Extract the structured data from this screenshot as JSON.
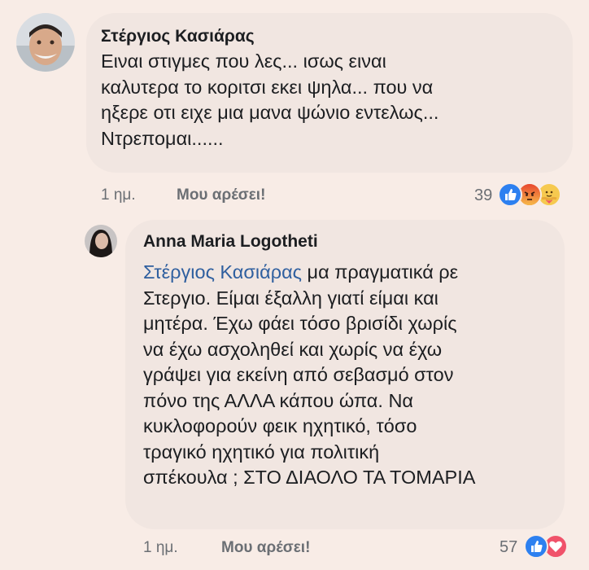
{
  "comments": [
    {
      "author": "Στέργιος Κασιάρας",
      "text_lines": [
        "Ειναι στιγμες που λες... ισως ειναι",
        "καλυτερα το κοριτσι εκει ψηλα... που να",
        "ηξερε οτι ειχε μια μανα ψώνιο εντελως...",
        "Ντρεπομαι......"
      ],
      "time": "1 ημ.",
      "like_label": "Μου αρέσει!",
      "reaction_count": "39",
      "reactions": [
        "like-icon",
        "angry-icon",
        "care-icon"
      ]
    },
    {
      "author": "Anna Maria Logotheti",
      "mention": "Στέργιος Κασιάρας",
      "first_line_rest": " μα πραγματικά ρε",
      "text_lines": [
        "Στεργιο. Είμαι έξαλλη γιατί είμαι και",
        "μητέρα. Έχω φάει τόσο βρισίδι χωρίς",
        "να έχω ασχοληθεί και χωρίς να έχω",
        "γράψει για εκείνη από σεβασμό στον",
        "πόνο της ΑΛΛΑ κάπου ώπα. Να",
        "κυκλοφορούν φεικ ηχητικό, τόσο",
        "τραγικό ηχητικό για πολιτική",
        "σπέκουλα ; ΣΤΟ ΔΙΑΟΛΟ ΤΑ ΤΟΜΑΡΙΑ"
      ],
      "time": "1 ημ.",
      "like_label": "Μου αρέσει!",
      "reaction_count": "57",
      "reactions": [
        "like-icon",
        "love-icon"
      ]
    }
  ]
}
